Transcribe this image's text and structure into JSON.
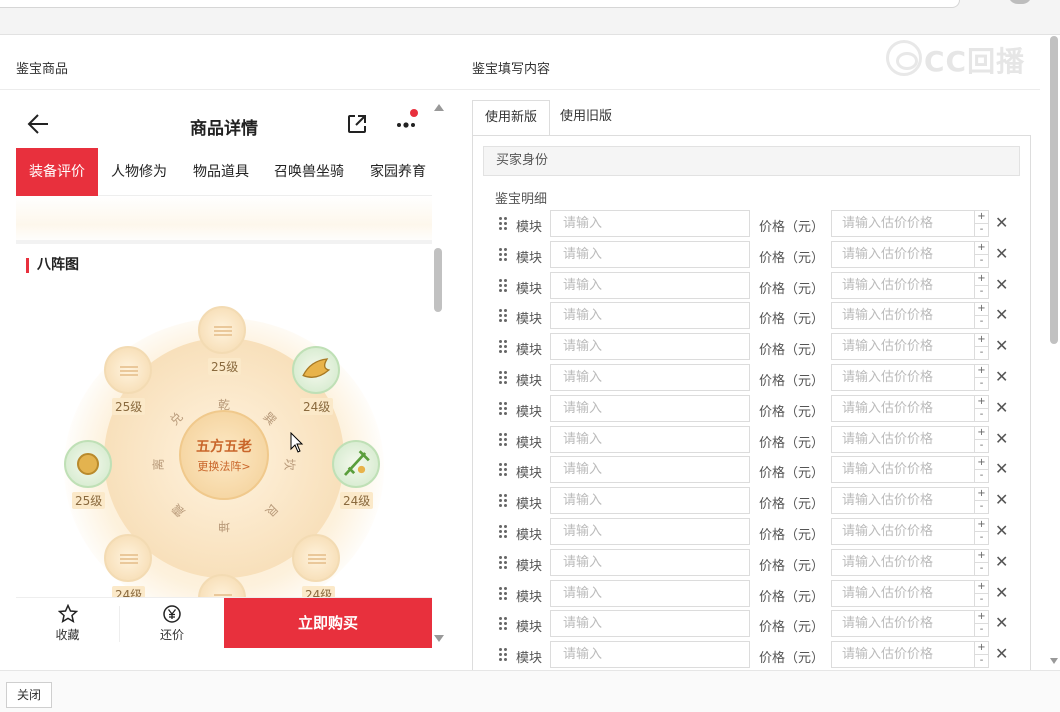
{
  "panels": {
    "left_title": "鉴宝商品",
    "right_title": "鉴宝填写内容"
  },
  "watermark": {
    "text": "CC回播"
  },
  "phone": {
    "title": "商品详情",
    "tabs": [
      "装备评价",
      "人物修为",
      "物品道具",
      "召唤兽坐骑",
      "家园养育"
    ],
    "section_title": "八阵图",
    "formation": {
      "center_title": "五方五老",
      "center_action": "更换法阵>",
      "trigrams": [
        "乾",
        "巽",
        "坎",
        "艮",
        "坤",
        "震",
        "离",
        "兑"
      ],
      "levels": [
        "25级",
        "24级",
        "24级",
        "24级",
        "24级",
        "25级",
        "25级",
        "25级"
      ]
    },
    "bottom": {
      "favorite": "收藏",
      "counter_offer": "还价",
      "buy": "立即购买"
    }
  },
  "form": {
    "tabs": [
      "使用新版",
      "使用旧版"
    ],
    "buyer_label": "买家身份",
    "detail_label": "鉴宝明细",
    "rows": [
      {
        "module_label": "模块",
        "module_placeholder": "请输入",
        "price_label": "价格（元）",
        "price_placeholder": "请输入估价价格"
      },
      {
        "module_label": "模块",
        "module_placeholder": "请输入",
        "price_label": "价格（元）",
        "price_placeholder": "请输入估价价格"
      },
      {
        "module_label": "模块",
        "module_placeholder": "请输入",
        "price_label": "价格（元）",
        "price_placeholder": "请输入估价价格"
      },
      {
        "module_label": "模块",
        "module_placeholder": "请输入",
        "price_label": "价格（元）",
        "price_placeholder": "请输入估价价格"
      },
      {
        "module_label": "模块",
        "module_placeholder": "请输入",
        "price_label": "价格（元）",
        "price_placeholder": "请输入估价价格"
      },
      {
        "module_label": "模块",
        "module_placeholder": "请输入",
        "price_label": "价格（元）",
        "price_placeholder": "请输入估价价格"
      },
      {
        "module_label": "模块",
        "module_placeholder": "请输入",
        "price_label": "价格（元）",
        "price_placeholder": "请输入估价价格"
      },
      {
        "module_label": "模块",
        "module_placeholder": "请输入",
        "price_label": "价格（元）",
        "price_placeholder": "请输入估价价格"
      },
      {
        "module_label": "模块",
        "module_placeholder": "请输入",
        "price_label": "价格（元）",
        "price_placeholder": "请输入估价价格"
      },
      {
        "module_label": "模块",
        "module_placeholder": "请输入",
        "price_label": "价格（元）",
        "price_placeholder": "请输入估价价格"
      },
      {
        "module_label": "模块",
        "module_placeholder": "请输入",
        "price_label": "价格（元）",
        "price_placeholder": "请输入估价价格"
      },
      {
        "module_label": "模块",
        "module_placeholder": "请输入",
        "price_label": "价格（元）",
        "price_placeholder": "请输入估价价格"
      },
      {
        "module_label": "模块",
        "module_placeholder": "请输入",
        "price_label": "价格（元）",
        "price_placeholder": "请输入估价价格"
      },
      {
        "module_label": "模块",
        "module_placeholder": "请输入",
        "price_label": "价格（元）",
        "price_placeholder": "请输入估价价格"
      },
      {
        "module_label": "模块",
        "module_placeholder": "请输入",
        "price_label": "价格（元）",
        "price_placeholder": "请输入估价价格"
      }
    ],
    "stepper_plus": "+",
    "stepper_minus": "-",
    "remove_symbol": "✕"
  },
  "footer": {
    "close_label": "关闭"
  },
  "colors": {
    "accent": "#e8303d",
    "border": "#dddddd"
  },
  "icons": [
    "back-arrow-icon",
    "share-icon",
    "more-icon",
    "star-icon",
    "yen-icon",
    "drag-handle-icon",
    "close-icon"
  ]
}
